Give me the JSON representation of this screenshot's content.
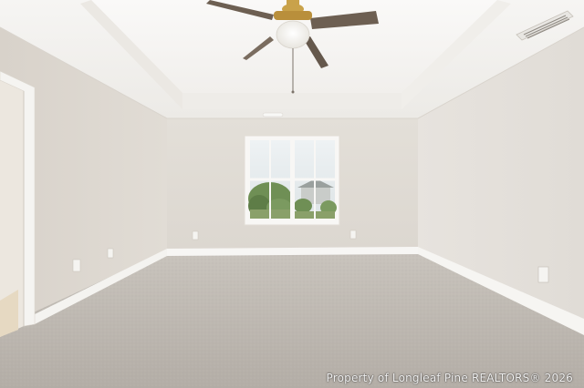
{
  "photo": {
    "subject": "empty-bedroom-interior",
    "watermark": "Property of Longleaf Pine REALTORS® 2026"
  },
  "colors": {
    "wall_left": "#dcd6ce",
    "wall_right": "#e4e0da",
    "wall_back": "#dfdad3",
    "ceiling": "#f4f2ef",
    "carpet": "#bdb7b0",
    "trim": "#f7f6f4",
    "fan_blade": "#6d5f52"
  }
}
